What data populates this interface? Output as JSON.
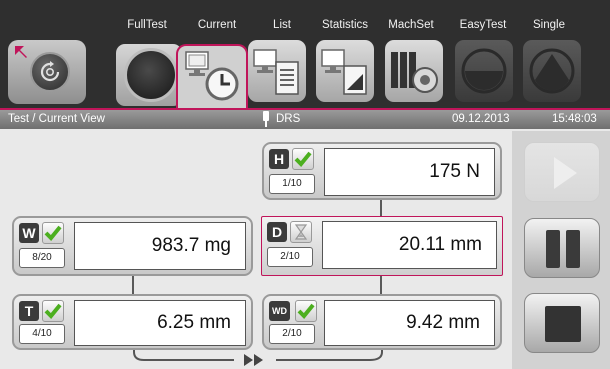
{
  "tabs": [
    {
      "label": "FullTest",
      "icon": "full-test-dial-icon"
    },
    {
      "label": "Current",
      "icon": "current-monitor-clock-icon"
    },
    {
      "label": "List",
      "icon": "list-monitor-icon"
    },
    {
      "label": "Statistics",
      "icon": "statistics-monitor-chart-icon"
    },
    {
      "label": "MachSet",
      "icon": "machine-settings-icon"
    },
    {
      "label": "EasyTest",
      "icon": "easy-test-dial-icon"
    },
    {
      "label": "Single",
      "icon": "single-dial-icon"
    }
  ],
  "selected_tab": "Current",
  "status": {
    "breadcrumb": "Test / Current View",
    "device": "DRS",
    "date": "09.12.2013",
    "time": "15:48:03"
  },
  "measurements": {
    "hardness": {
      "letter": "H",
      "status": "ok",
      "count": "1/10",
      "value": "175 N"
    },
    "weight": {
      "letter": "W",
      "status": "ok",
      "count": "8/20",
      "value": "983.7 mg"
    },
    "diameter": {
      "letter": "D",
      "status": "running",
      "count": "2/10",
      "value": "20.11 mm"
    },
    "thickness": {
      "letter": "T",
      "status": "ok",
      "count": "4/10",
      "value": "6.25 mm"
    },
    "wall_diameter": {
      "letter": "WD",
      "status": "ok",
      "count": "2/10",
      "value": "9.42 mm"
    }
  },
  "controls": {
    "play": {
      "icon": "play-icon",
      "enabled": false
    },
    "pause": {
      "icon": "pause-icon",
      "enabled": true
    },
    "stop": {
      "icon": "stop-icon",
      "enabled": true
    }
  },
  "colors": {
    "accent": "#c0155a",
    "check": "#4caf1f"
  }
}
